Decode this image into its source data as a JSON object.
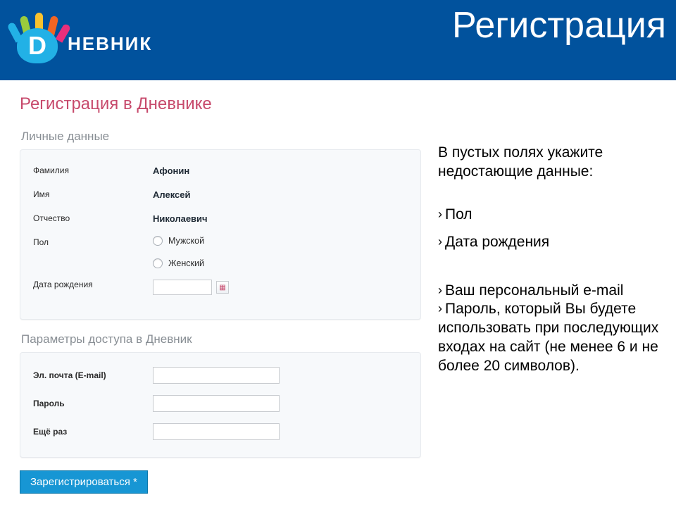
{
  "brand": {
    "d_letter": "D",
    "word": "НЕВНИК"
  },
  "slide_title": "Регистрация",
  "page_heading": "Регистрация в Дневнике",
  "personal": {
    "title": "Личные данные",
    "labels": {
      "lastname": "Фамилия",
      "firstname": "Имя",
      "patronymic": "Отчество",
      "gender": "Пол",
      "dob": "Дата рождения"
    },
    "values": {
      "lastname": "Афонин",
      "firstname": "Алексей",
      "patronymic": "Николаевич"
    },
    "gender_options": {
      "male": "Мужской",
      "female": "Женский"
    }
  },
  "access": {
    "title": "Параметры доступа в Дневник",
    "labels": {
      "email": "Эл. почта (E-mail)",
      "password": "Пароль",
      "password2": "Ещё раз"
    },
    "values": {
      "email": "",
      "password": "",
      "password2": ""
    }
  },
  "submit_label": "Зарегистрироваться *",
  "hints": {
    "head": "В пустых полях укажите недостающие данные:",
    "group1": [
      "Пол",
      "Дата рождения"
    ],
    "group2": [
      "Ваш персональный e-mail",
      "Пароль, который Вы будете использовать при последующих входах на сайт (не менее 6 и не более 20 символов)."
    ]
  }
}
